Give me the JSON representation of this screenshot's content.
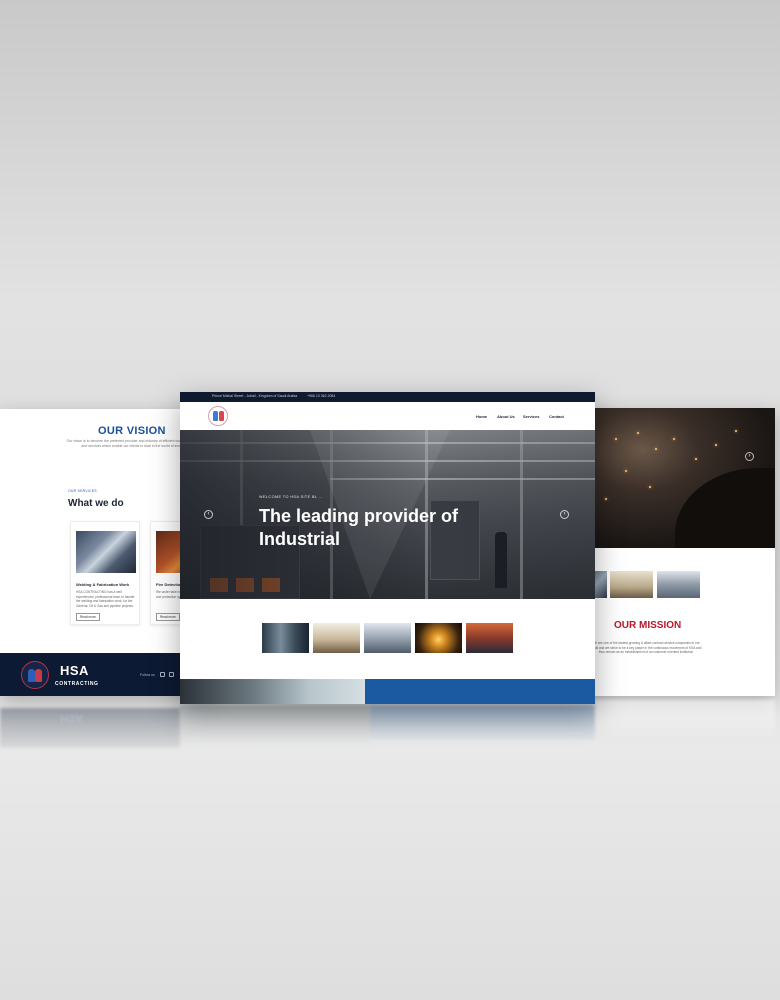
{
  "left_panel": {
    "vision_title": "OUR VISION",
    "vision_text": "Our vision is to become the preferred provider and industry of efficient workforce solutions and services which enable our clients to lead in the world of innovation",
    "services_label": "OUR SERVICES",
    "services_heading": "What we do",
    "cards": [
      {
        "title": "Welding & Fabrication Work",
        "desc": "HSA CONTRACTING has a well experienced, professional team to handle the welding and fabrication work, for the General, Oil & Gas and pipeline projects.",
        "button": "Read more"
      },
      {
        "title": "Fire Detection",
        "desc": "We under take installation of fire detection and protection systems for projects",
        "button": "Read more"
      }
    ],
    "footer": {
      "brand": "HSA",
      "brand_sub": "CONTRACTING",
      "follow_label": "Follow us"
    }
  },
  "center_panel": {
    "topbar": {
      "address": "Prince Mishal Street - Jubail - Kingdom of Saudi Arabia",
      "phone": "+966 13 362 2084"
    },
    "nav": [
      "Home",
      "About Us",
      "Services",
      "Contact"
    ],
    "hero": {
      "welcome": "WELCOME TO HSA SITE BL ...",
      "headline": "The leading provider of Industrial"
    }
  },
  "right_panel": {
    "mission_title": "OUR MISSION",
    "mission_text": "We are one of the fastest growing & allied contract service companies in our fields and we strive to be a key player in the continuous movement of KSA and thus remain as an establishment of an customer oriented institution"
  },
  "reflection": {
    "brand_mirror": "HSA"
  },
  "colors": {
    "navy": "#0f1a31",
    "brand_blue": "#1a4f9c",
    "mission_red": "#b8192e",
    "footer_blue": "#1b5aa0"
  },
  "icons": [
    "chevron-left-icon",
    "chevron-right-icon",
    "facebook-icon",
    "instagram-icon",
    "location-pin-icon",
    "phone-icon",
    "hsa-logo"
  ]
}
